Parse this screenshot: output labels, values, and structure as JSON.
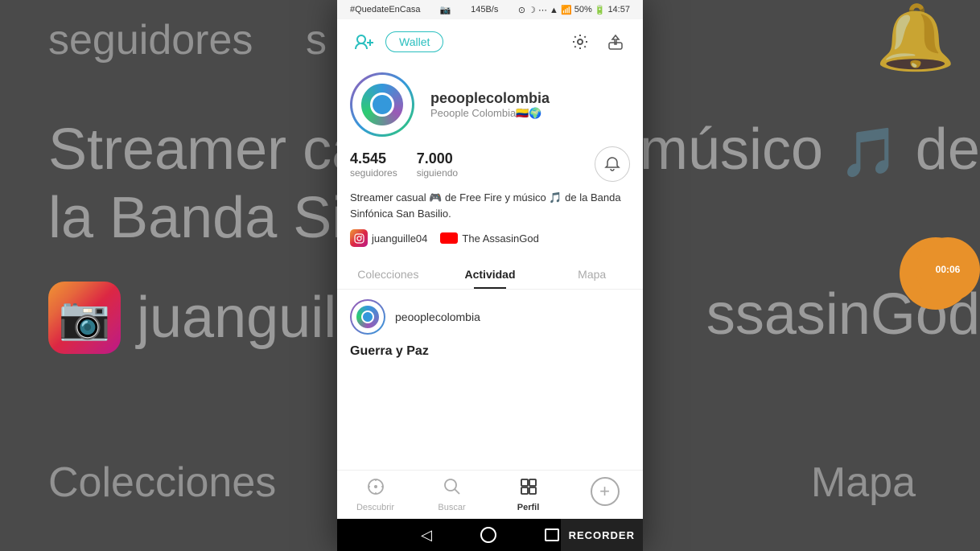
{
  "status_bar": {
    "hashtag": "#QuedateEnCasa",
    "camera_icon": "📷",
    "speed": "145B/s",
    "time": "14:57",
    "battery": "50%"
  },
  "top_bar": {
    "wallet_label": "Wallet",
    "add_person_icon": "add-person-icon",
    "settings_icon": "settings-icon",
    "share_icon": "share-icon"
  },
  "profile": {
    "username": "peooplecolombia",
    "realname": "Peoople Colombia🇨🇴🌍",
    "followers_count": "4.545",
    "followers_label": "seguidores",
    "following_count": "7.000",
    "following_label": "siguiendo",
    "bio": "Streamer casual 🎮 de Free Fire  y músico 🎵 de la Banda Sinfónica San Basilio."
  },
  "social_links": {
    "instagram_handle": "juanguille04",
    "youtube_channel": "The AssasinGod"
  },
  "tabs": {
    "colecciones": "Colecciones",
    "actividad": "Actividad",
    "mapa": "Mapa",
    "active": "actividad"
  },
  "activity_feed": {
    "items": [
      {
        "username": "peooplecolombia",
        "avatar": "circle"
      }
    ],
    "post_title": "Guerra y Paz"
  },
  "bottom_nav": {
    "descubrir_label": "Descubrir",
    "buscar_label": "Buscar",
    "perfil_label": "Perfil",
    "descubrir_icon": "compass-icon",
    "buscar_icon": "search-icon",
    "perfil_icon": "grid-icon",
    "plus_icon": "plus-icon"
  },
  "android_nav": {
    "recorder_label": "RECORDER",
    "back_symbol": "◁",
    "home_symbol": "○",
    "recents_symbol": "□"
  },
  "background": {
    "seguidores_text": "seguidores",
    "s_text": "s",
    "streamer_text": "Streamer casual",
    "banda_text": "la Banda Sinfón",
    "instagram_text": "juanguille",
    "assassin_text": "ssasinGod",
    "colecciones_text": "Colecciones",
    "mapa_text": "Mapa",
    "timer_text": "00:06"
  }
}
